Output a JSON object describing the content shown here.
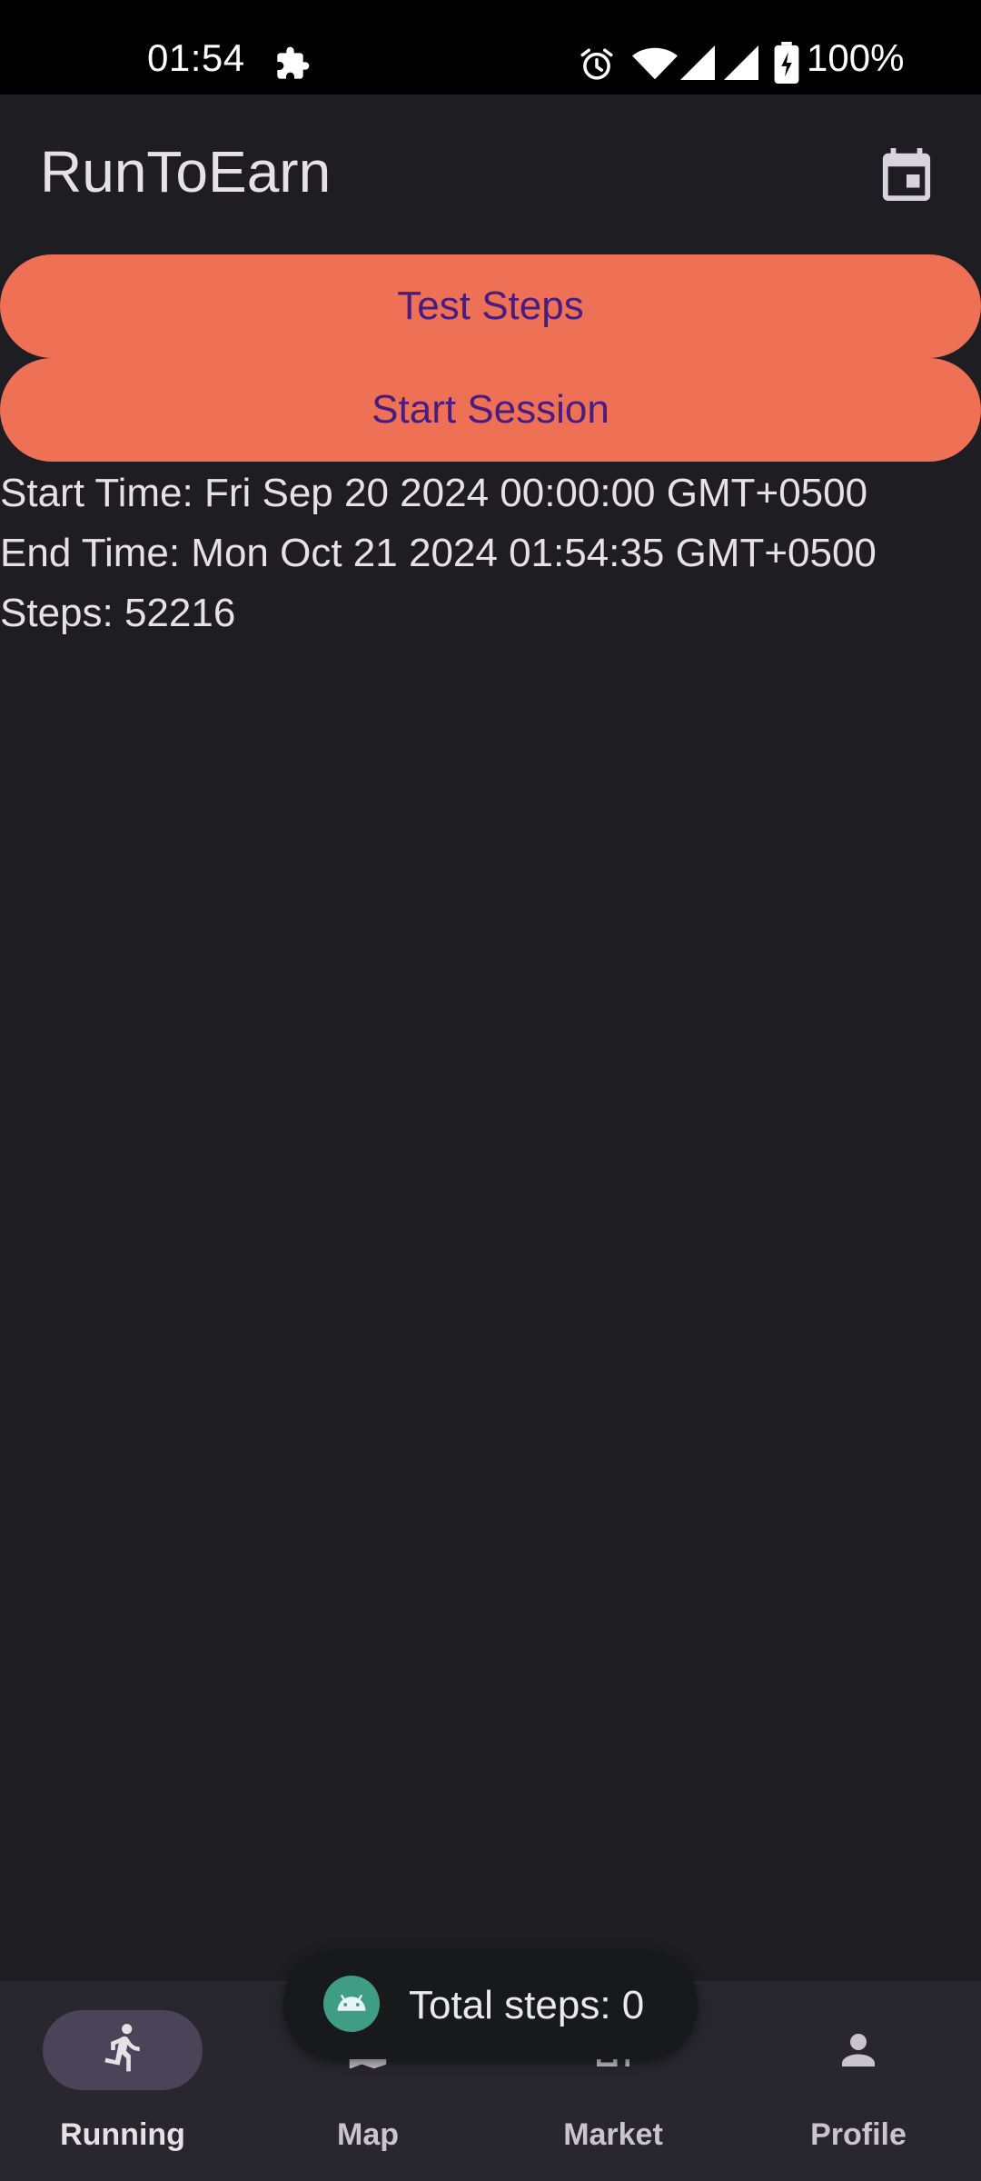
{
  "status_bar": {
    "time": "01:54",
    "battery": "100%",
    "icons": [
      "puzzle-icon",
      "alarm-icon",
      "wifi-icon",
      "signal-icon",
      "battery-charging-icon"
    ]
  },
  "app_bar": {
    "title": "RunToEarn",
    "action_icon": "calendar-icon"
  },
  "buttons": {
    "test_steps": "Test Steps",
    "start_session": "Start Session"
  },
  "info": {
    "start_time": "Start Time: Fri Sep 20 2024 00:00:00 GMT+0500",
    "end_time": "End Time: Mon Oct 21 2024 01:54:35 GMT+0500",
    "steps": "Steps: 52216"
  },
  "bottom_nav": {
    "items": [
      {
        "label": "Running",
        "icon": "running-icon",
        "active": true
      },
      {
        "label": "Map",
        "icon": "map-icon",
        "active": false
      },
      {
        "label": "Market",
        "icon": "market-icon",
        "active": false
      },
      {
        "label": "Profile",
        "icon": "person-icon",
        "active": false
      }
    ]
  },
  "toast": {
    "text": "Total steps: 0",
    "icon": "android-icon"
  },
  "colors": {
    "background": "#1e1d22",
    "button": "#ee7055",
    "button_text": "#4a1c7f",
    "nav_background": "#28272d",
    "nav_indicator": "#4a4458"
  }
}
